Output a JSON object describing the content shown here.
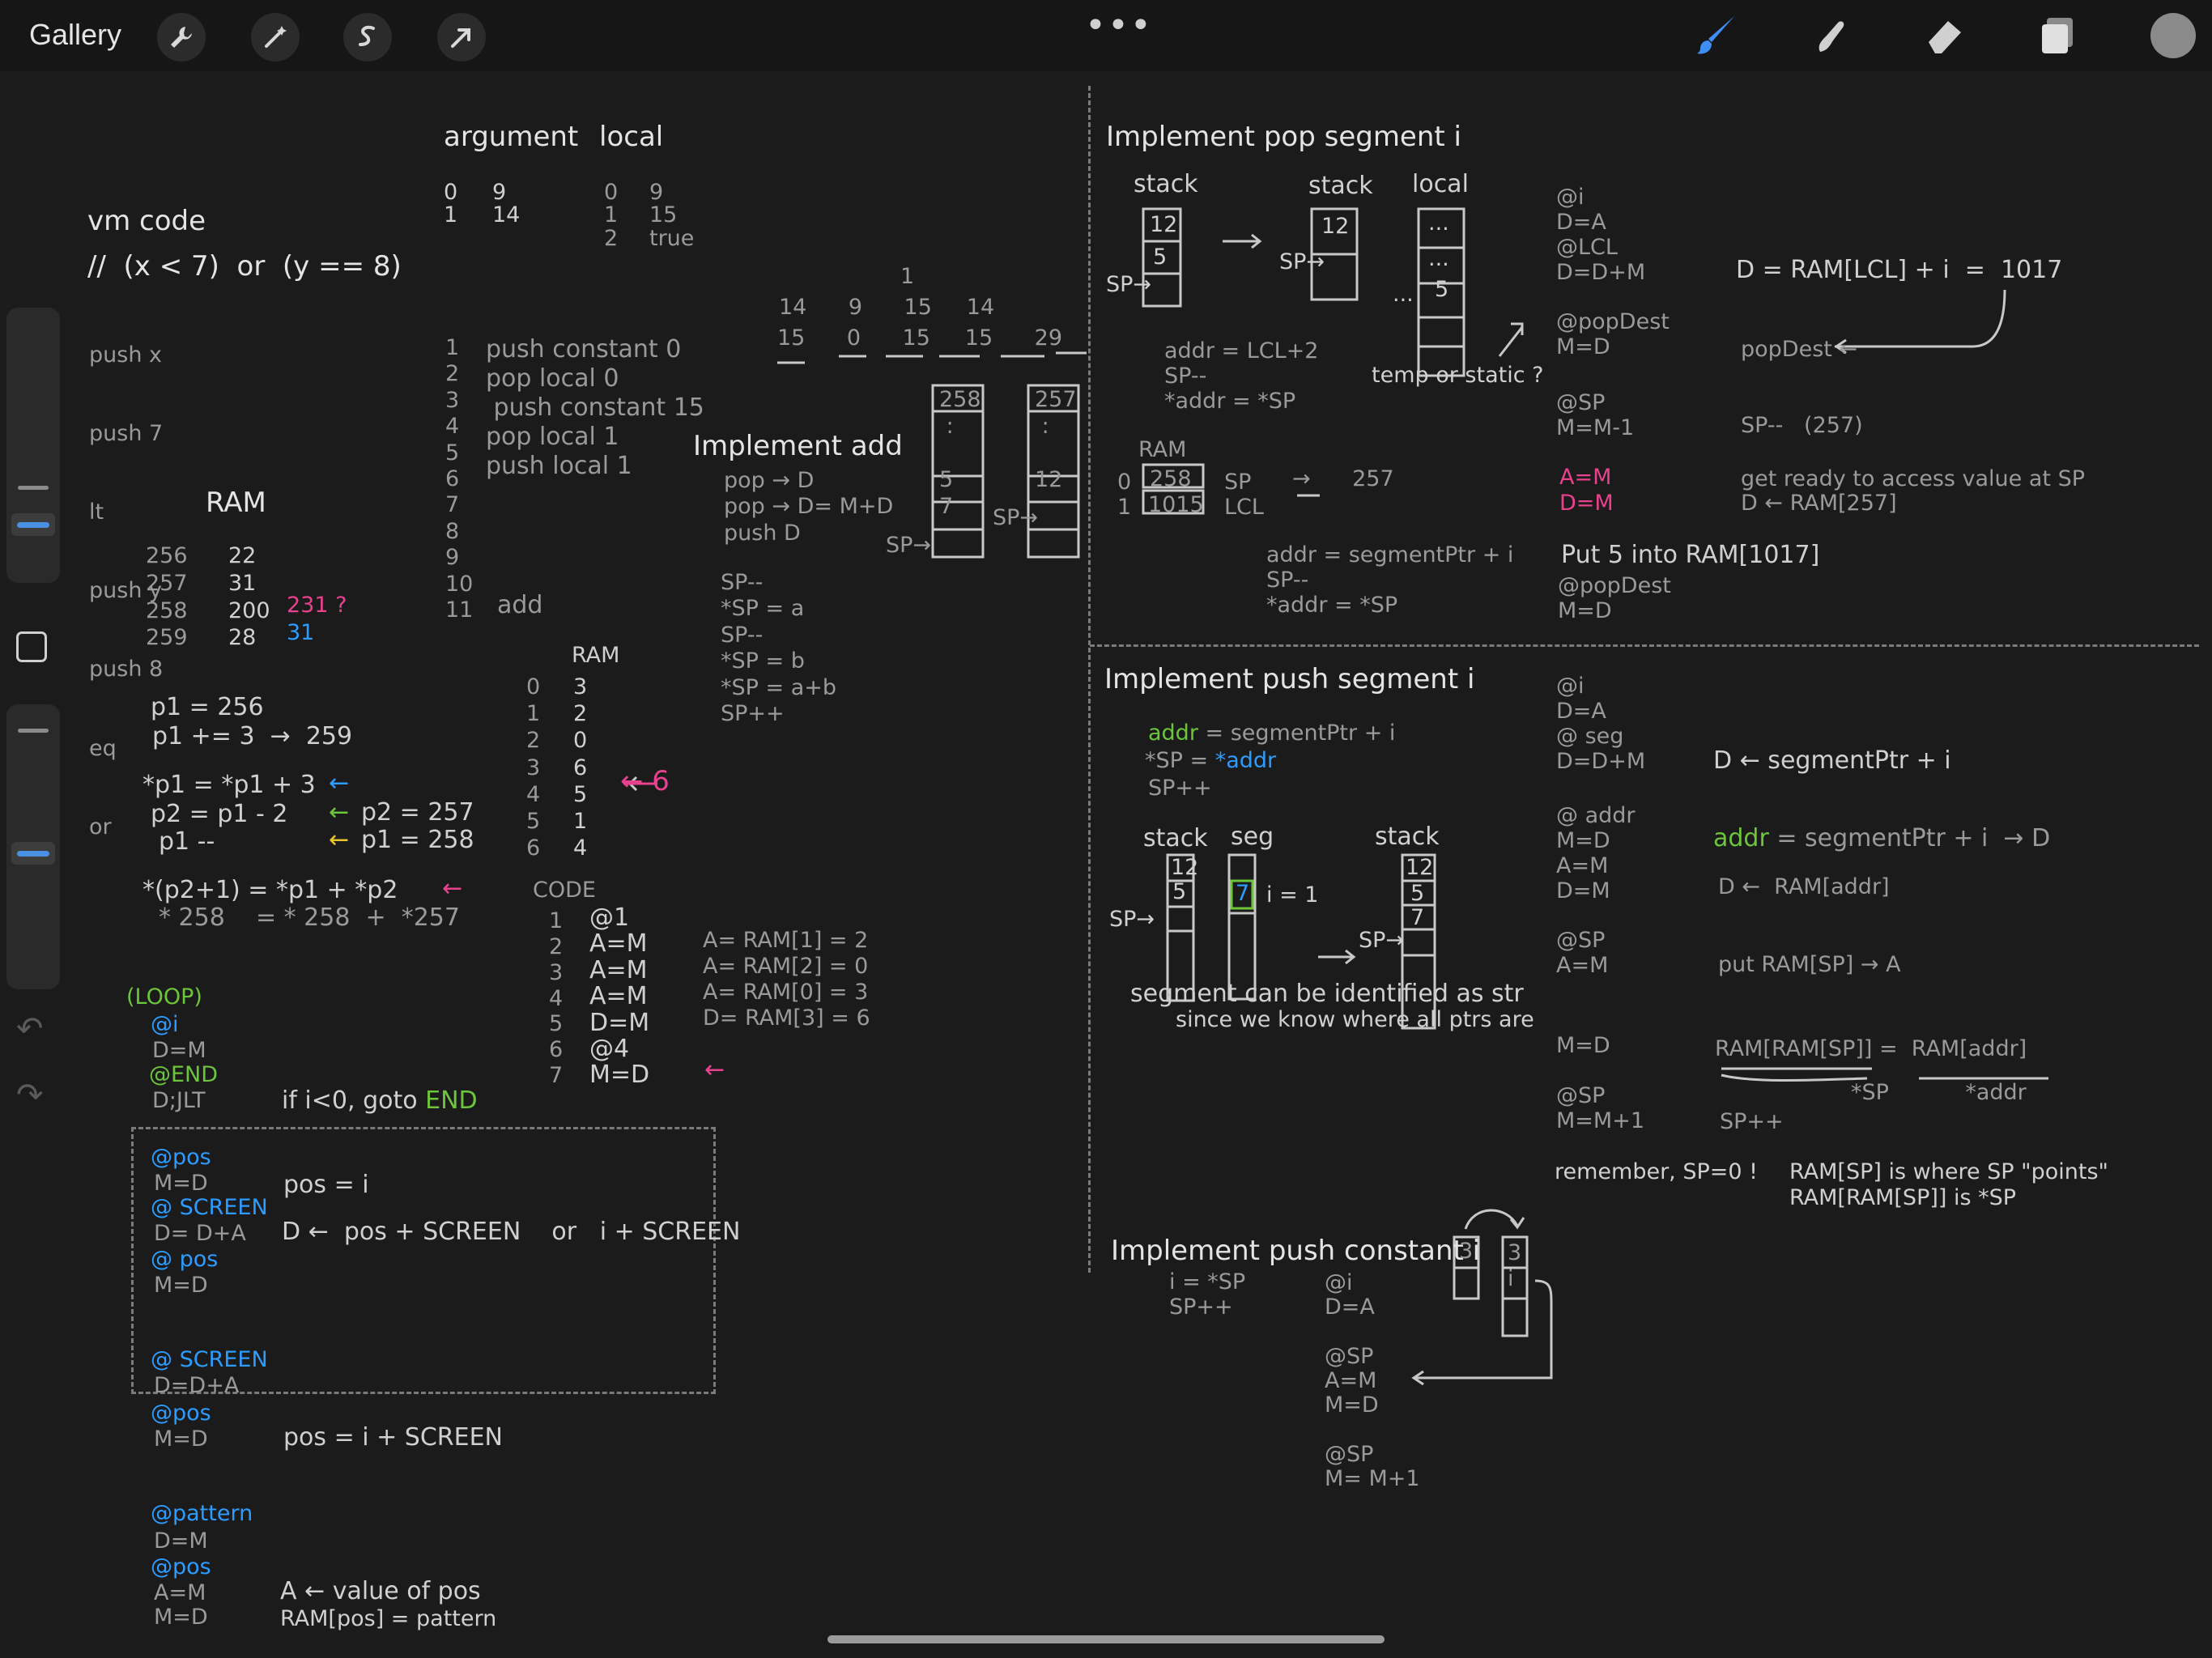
{
  "toolbar": {
    "gallery_label": "Gallery",
    "left_tools": [
      "wrench-icon",
      "magic-wand-icon",
      "selection-icon",
      "transform-arrow-icon"
    ],
    "more_label": "•••",
    "right_tools": [
      "brush-icon",
      "smudge-icon",
      "eraser-icon",
      "layers-icon",
      "color-swatch"
    ],
    "active_tool_color": "#3e8ef7",
    "swatch_color": "#8a8a8a"
  },
  "sidebar": {
    "modify_icon": "square-modify-icon",
    "undo_icon": "undo-icon",
    "redo_icon": "redo-icon",
    "slider_color": "#4a90e2"
  },
  "notes": {
    "vm": {
      "title": "vm code",
      "comment": "//  (x < 7)  or  (y == 8)",
      "lines": [
        "push x",
        "push 7",
        "lt",
        "push y",
        "push 8",
        "eq",
        "or"
      ]
    },
    "args": {
      "h_argument": "argument",
      "h_local": "local",
      "arg_idx": "0\n1",
      "arg_val": "9\n14",
      "loc_idx": "0\n1\n2",
      "loc_val": "9\n15\ntrue"
    },
    "vm_prog": {
      "nums": "1\n2\n3\n4\n5\n6\n7\n8\n9\n10\n11",
      "lines": "push constant 0\npop local 0\n push constant 15\npop local 1\npush local 1",
      "add": "add"
    },
    "stack_row": {
      "one": "1",
      "r1": "14      9      15     14",
      "r2": "15      0      15     15      29"
    },
    "impl_add": {
      "title": "Implement add",
      "lines": "pop → D\npop → D= M+D\npush D",
      "star": "SP--\n*SP = a\nSP--\n*SP = b\n*SP = a+b\nSP++",
      "st1": "258\n :\n\n5\n7",
      "st2": "257\n :\n\n12",
      "sp": "SP→"
    },
    "ram_left": {
      "title": "RAM",
      "addr": "256\n257\n258\n259",
      "val": "22\n31\n200\n28",
      "q": "231 ?",
      "q2": "31"
    },
    "pointers": {
      "p1": "p1 = 256",
      "p1b": "p1 += 3  →  259",
      "l1": "*p1 = *p1 + 3",
      "l2": "p2 = p1 - 2",
      "l3": "p1 --",
      "r2": "p2 = 257",
      "r3": "p1 = 258",
      "l4": "*(p2+1) = *p1 + *p2",
      "l5": "* 258    = * 258  +  *257"
    },
    "ram_mid": {
      "title": "RAM",
      "addr": "0\n1\n2\n3\n4\n5\n6",
      "val": "3\n2\n0\n6\n5\n1\n4",
      "six": "← 6"
    },
    "code": {
      "title": "CODE",
      "nums": "1\n2\n3\n4\n5\n6\n7",
      "lines": "@1\nA=M\nA=M\nA=M\nD=M\n@4\nM=D",
      "notes": "A= RAM[1] = 2\nA= RAM[2] = 0\nA= RAM[0] = 3\nD= RAM[3] = 6",
      "arrow": "←"
    },
    "loop": {
      "label": "(LOOP)",
      "at_i": "@i",
      "dm": "D=M",
      "end": "@END",
      "jlt": "D;JLT",
      "comment_a": "if i<0, goto ",
      "comment_b": "END"
    },
    "box": {
      "pos1": "@pos",
      "md": "M=D",
      "screen": "@ SCREEN",
      "dda": "D= D+A",
      "pos2": "@ pos",
      "md2": "M=D",
      "c1": "pos = i",
      "c2": "D ←  pos + SCREEN    or   i + SCREEN"
    },
    "bottom_left": {
      "screen": "@ SCREEN",
      "dda": "D=D+A",
      "pos": "@pos",
      "md": "M=D",
      "comment": "pos = i + SCREEN",
      "pattern": "@pattern",
      "dm": "D=M",
      "pos2": "@pos",
      "am": "A=M",
      "md2": "M=D",
      "c1": "A ← value of pos",
      "c2": "RAM[pos] = pattern"
    },
    "pop": {
      "title_a": "Implement ",
      "title_b": "pop segment i",
      "stack": "stack",
      "local": "local",
      "c12": "12",
      "c5": "5",
      "ldots": "...",
      "sp": "SP→",
      "addr": "addr = LCL+2\nSP--\n*addr = *SP",
      "temp": "temp or static ?",
      "ram": "RAM",
      "ram_idx": "0\n1",
      "ram_v1": "258",
      "ram_v2": "1015",
      "ram_lbl": "SP\nLCL",
      "arrow257": "→      257",
      "seg": "addr = segmentPtr + i\nSP--\n*addr = *SP",
      "code1": "@i\nD=A\n@LCL\nD=D+M",
      "d_eq": "D = RAM[LCL] + i  =  1017",
      "code2": "@popDest\nM=D",
      "popdest": "popDest ←",
      "code3": "@SP\nM=M-1",
      "spm": "SP--   (257)",
      "am": "A=M",
      "dm": "D=M",
      "ready": "get ready to access value at SP",
      "ready2": "D ← RAM[257]",
      "put5": "Put 5 into RAM[1017]",
      "code4": "@popDest\nM=D"
    },
    "push": {
      "title_a": "Implement ",
      "title_b": "push segment i",
      "addr_a": "addr",
      "addr_b": " = segmentPtr + i",
      "sp_a": "*SP = ",
      "sp_b": "*addr",
      "spp": "SP++",
      "stack": "stack",
      "seg": "seg",
      "i1": "i = 1",
      "c12": "12",
      "c5": "5",
      "c7": "7",
      "sp": "SP→",
      "note1": "segment can be identified as str",
      "note2": "since we know where all ptrs are",
      "code1": "@i\nD=A\n@ seg\nD=D+M",
      "dseg": "D ← segmentPtr + i",
      "code2": "@ addr\nM=D\nA=M\nD=M",
      "addr_g": "addr",
      "addr_r": " = segmentPtr + i  → D",
      "daddr": "D ←  RAM[addr]",
      "code3": "@SP\nA=M",
      "putram": "put RAM[SP] → A",
      "md": "M=D",
      "ramram": "RAM[RAM[SP]] =  RAM[addr]",
      "starsp": "*SP           *addr",
      "code4": "@SP\nM=M+1",
      "spp2": "SP++",
      "remember": "remember, SP=0 !",
      "rem2": "RAM[SP] is where SP \"points\"",
      "rem3": "RAM[RAM[SP]] is *SP"
    },
    "pushc": {
      "title_a": "Implement ",
      "title_b": "push constant i",
      "l1": "i = *SP\nSP++",
      "code": "@i\nD=A\n\n@SP\nA=M\nM=D\n\n@SP\nM= M+1",
      "c3": "3",
      "ci": "3\ni"
    }
  }
}
